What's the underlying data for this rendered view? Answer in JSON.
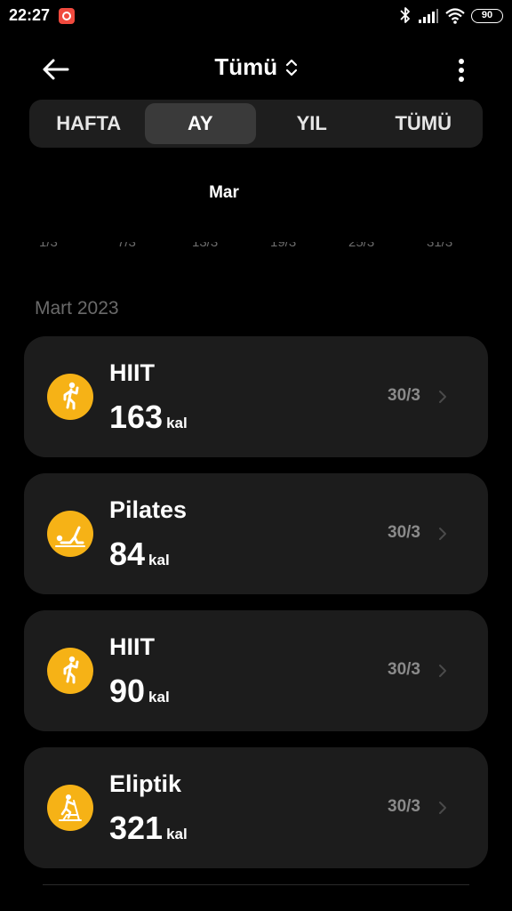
{
  "status": {
    "time": "22:27",
    "battery": "90",
    "icons": [
      "app-notification-icon",
      "bluetooth-icon",
      "signal-icon",
      "wifi-icon",
      "battery-icon"
    ]
  },
  "header": {
    "title": "Tümü",
    "icons": [
      "back-arrow-icon",
      "sort-toggle-icon",
      "more-vert-icon"
    ]
  },
  "tabs": [
    {
      "label": "HAFTA",
      "active": false
    },
    {
      "label": "AY",
      "active": true
    },
    {
      "label": "YIL",
      "active": false
    },
    {
      "label": "TÜMÜ",
      "active": false
    }
  ],
  "chart": {
    "month": "Mar",
    "ticks": [
      "1/3",
      "7/3",
      "13/3",
      "19/3",
      "25/3",
      "31/3"
    ]
  },
  "section": {
    "title": "Mart 2023"
  },
  "records": [
    {
      "name": "HIIT",
      "value": "163",
      "unit": "kal",
      "date": "30/3",
      "icon": "hiit-icon"
    },
    {
      "name": "Pilates",
      "value": "84",
      "unit": "kal",
      "date": "30/3",
      "icon": "pilates-icon"
    },
    {
      "name": "HIIT",
      "value": "90",
      "unit": "kal",
      "date": "30/3",
      "icon": "hiit-icon"
    },
    {
      "name": "Eliptik",
      "value": "321",
      "unit": "kal",
      "date": "30/3",
      "icon": "elliptical-icon"
    }
  ],
  "colors": {
    "background": "#000000",
    "card": "#1c1c1c",
    "accent": "#f6b216",
    "muted_text": "#8a8a8a",
    "active_tab": "#3a3a3a"
  }
}
